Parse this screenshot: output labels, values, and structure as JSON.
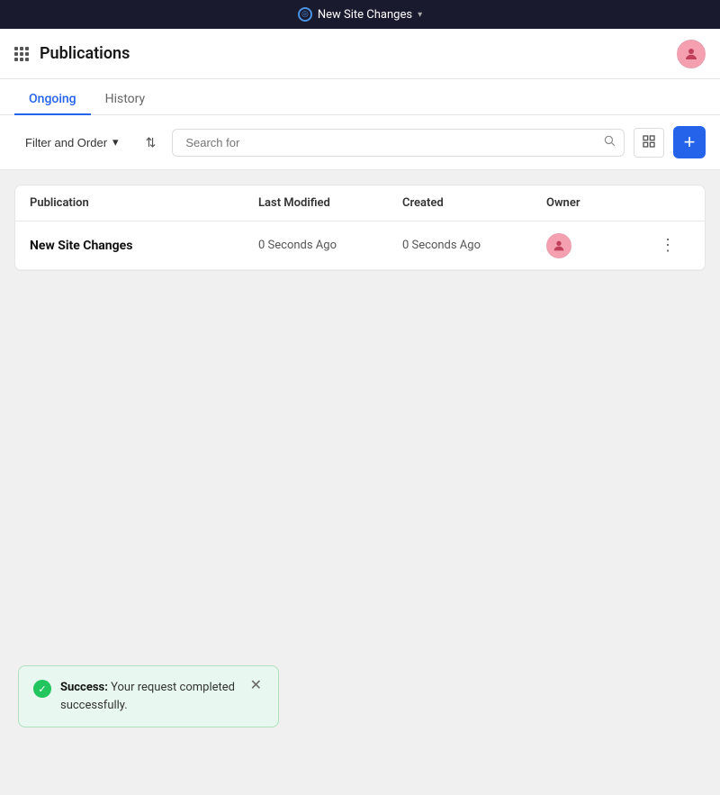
{
  "topbar": {
    "title": "New Site Changes",
    "chevron": "▾",
    "icon_char": "◎"
  },
  "header": {
    "title": "Publications",
    "avatar_icon": "👤"
  },
  "tabs": [
    {
      "label": "Ongoing",
      "active": true
    },
    {
      "label": "History",
      "active": false
    }
  ],
  "toolbar": {
    "filter_label": "Filter and Order",
    "filter_chevron": "▾",
    "sort_icon": "⇅",
    "search_placeholder": "Search for",
    "search_icon": "🔍",
    "view_icon": "⊞",
    "add_icon": "+"
  },
  "table": {
    "columns": [
      "Publication",
      "Last Modified",
      "Created",
      "Owner"
    ],
    "rows": [
      {
        "name": "New Site Changes",
        "last_modified": "0 Seconds Ago",
        "created": "0 Seconds Ago",
        "owner_icon": "👤"
      }
    ]
  },
  "toast": {
    "success_label": "Success:",
    "message": "Your request completed successfully.",
    "close_icon": "✕"
  }
}
